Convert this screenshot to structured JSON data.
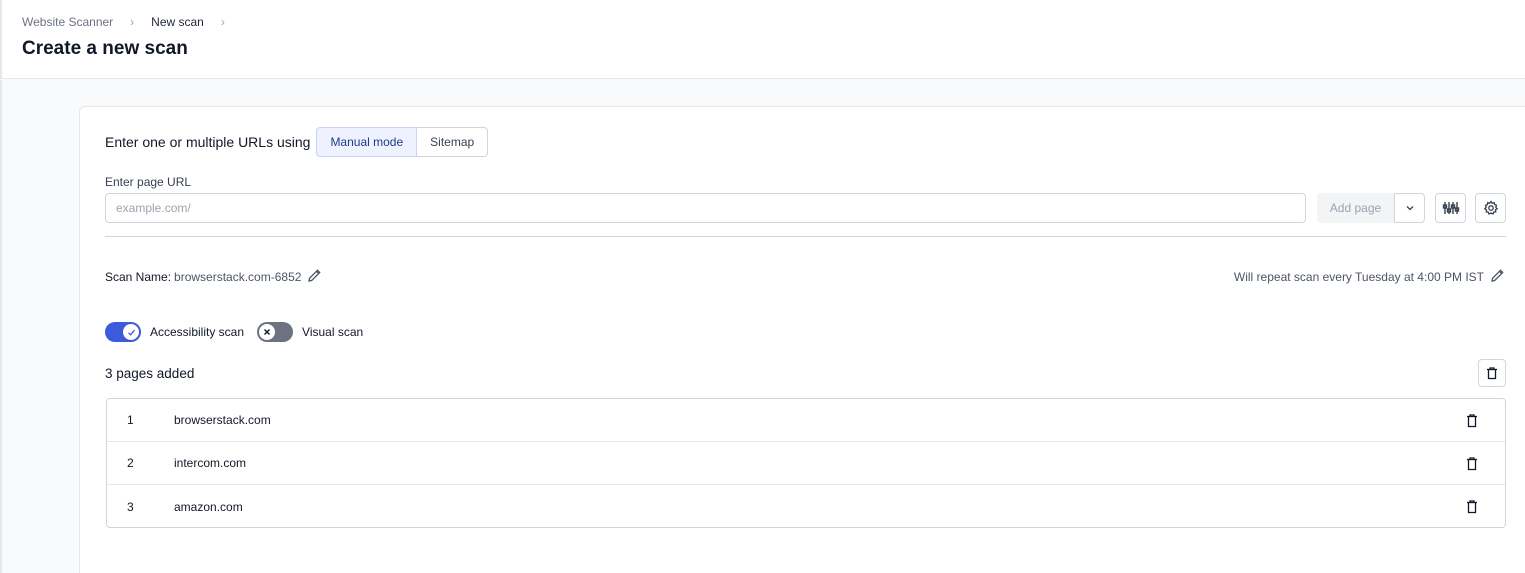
{
  "breadcrumb": {
    "items": [
      "Website Scanner",
      "New scan"
    ],
    "separator": "›"
  },
  "page": {
    "title": "Create a new scan"
  },
  "mode": {
    "prompt": "Enter one or multiple URLs using",
    "options": [
      "Manual mode",
      "Sitemap"
    ],
    "selected": "Manual mode"
  },
  "url_field": {
    "label": "Enter page URL",
    "placeholder": "example.com/",
    "value": ""
  },
  "add_page": {
    "label": "Add page"
  },
  "scan": {
    "name_label": "Scan Name:",
    "name_value": "browserstack.com-6852",
    "repeat_text": "Will repeat scan every Tuesday at 4:00 PM IST"
  },
  "toggles": [
    {
      "label": "Accessibility scan",
      "on": true
    },
    {
      "label": "Visual scan",
      "on": false
    }
  ],
  "pages": {
    "count_text": "3 pages added",
    "rows": [
      {
        "index": "1",
        "url": "browserstack.com"
      },
      {
        "index": "2",
        "url": "intercom.com"
      },
      {
        "index": "3",
        "url": "amazon.com"
      }
    ]
  },
  "colors": {
    "accent": "#3b5bdb",
    "toggle_off": "#6b7280",
    "border": "#d1d5db"
  },
  "icons": [
    "chevron-right-icon",
    "chevron-down-icon",
    "sliders-icon",
    "gear-icon",
    "pencil-icon",
    "check-icon",
    "x-icon",
    "trash-icon"
  ]
}
